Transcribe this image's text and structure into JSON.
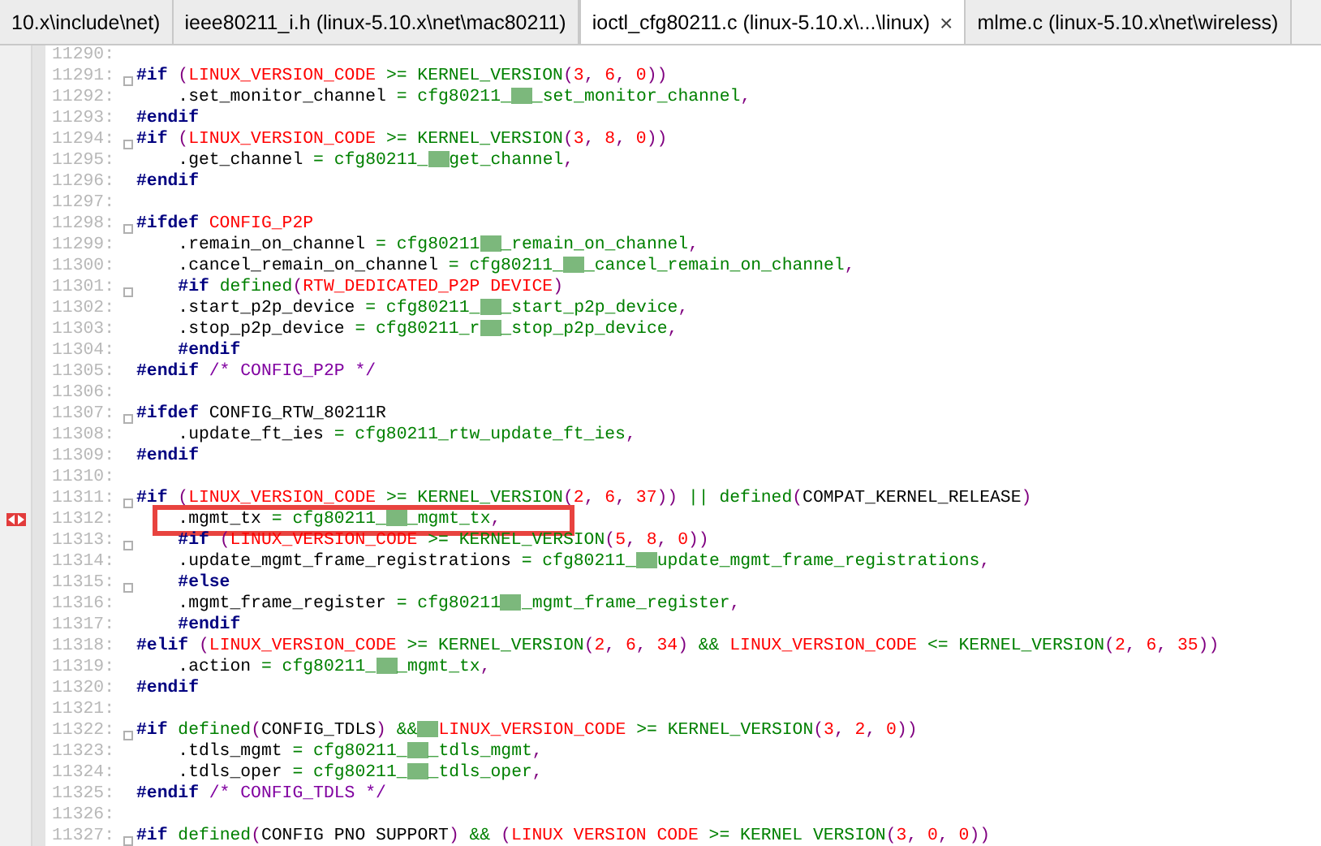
{
  "tabs": [
    {
      "label": "10.x\\include\\net)",
      "selected": false
    },
    {
      "label": "ieee80211_i.h (linux-5.10.x\\net\\mac80211)",
      "selected": false
    },
    {
      "label": "ioctl_cfg80211.c (linux-5.10.x\\...\\linux)",
      "selected": true
    },
    {
      "label": "mlme.c (linux-5.10.x\\net\\wireless)",
      "selected": false
    }
  ],
  "close_glyph": "×",
  "lines": [
    {
      "number": "11290:",
      "fold": false,
      "marker": false,
      "annotated": false
    },
    {
      "number": "11291:",
      "fold": true,
      "marker": false,
      "annotated": false,
      "tokens": [
        {
          "kind": "kw",
          "text": "#if"
        },
        {
          "kind": "p",
          "text": " ("
        },
        {
          "kind": "mac",
          "text": "LINUX_VERSION_CODE"
        },
        {
          "kind": "fn",
          "text": " >= KERNEL_VERSION"
        },
        {
          "kind": "p",
          "text": "("
        },
        {
          "kind": "num",
          "text": "3"
        },
        {
          "kind": "p",
          "text": ", "
        },
        {
          "kind": "num",
          "text": "6"
        },
        {
          "kind": "p",
          "text": ", "
        },
        {
          "kind": "num",
          "text": "0"
        },
        {
          "kind": "p",
          "text": "))"
        }
      ]
    },
    {
      "number": "11292:",
      "fold": false,
      "marker": false,
      "annotated": false,
      "tokens": [
        {
          "kind": "t",
          "text": "    .set_monitor_channel "
        },
        {
          "kind": "fn",
          "text": "= cfg80211_"
        },
        {
          "kind": "blur"
        },
        {
          "kind": "fn",
          "text": "_set_monitor_channel"
        },
        {
          "kind": "p",
          "text": ","
        }
      ]
    },
    {
      "number": "11293:",
      "fold": false,
      "marker": false,
      "annotated": false,
      "tokens": [
        {
          "kind": "kw",
          "text": "#endif"
        }
      ]
    },
    {
      "number": "11294:",
      "fold": true,
      "marker": false,
      "annotated": false,
      "tokens": [
        {
          "kind": "kw",
          "text": "#if"
        },
        {
          "kind": "p",
          "text": " ("
        },
        {
          "kind": "mac",
          "text": "LINUX_VERSION_CODE"
        },
        {
          "kind": "fn",
          "text": " >= KERNEL_VERSION"
        },
        {
          "kind": "p",
          "text": "("
        },
        {
          "kind": "num",
          "text": "3"
        },
        {
          "kind": "p",
          "text": ", "
        },
        {
          "kind": "num",
          "text": "8"
        },
        {
          "kind": "p",
          "text": ", "
        },
        {
          "kind": "num",
          "text": "0"
        },
        {
          "kind": "p",
          "text": "))"
        }
      ]
    },
    {
      "number": "11295:",
      "fold": false,
      "marker": false,
      "annotated": false,
      "tokens": [
        {
          "kind": "t",
          "text": "    .get_channel "
        },
        {
          "kind": "fn",
          "text": "= cfg80211_"
        },
        {
          "kind": "blur"
        },
        {
          "kind": "fn",
          "text": "get_channel"
        },
        {
          "kind": "p",
          "text": ","
        }
      ]
    },
    {
      "number": "11296:",
      "fold": false,
      "marker": false,
      "annotated": false,
      "tokens": [
        {
          "kind": "kw",
          "text": "#endif"
        }
      ]
    },
    {
      "number": "11297:",
      "fold": false,
      "marker": false,
      "annotated": false
    },
    {
      "number": "11298:",
      "fold": true,
      "marker": false,
      "annotated": false,
      "tokens": [
        {
          "kind": "kw",
          "text": "#ifdef"
        },
        {
          "kind": "mac",
          "text": " CONFIG_P2P"
        }
      ]
    },
    {
      "number": "11299:",
      "fold": false,
      "marker": false,
      "annotated": false,
      "tokens": [
        {
          "kind": "t",
          "text": "    .remain_on_channel "
        },
        {
          "kind": "fn",
          "text": "= cfg80211"
        },
        {
          "kind": "blur"
        },
        {
          "kind": "fn",
          "text": "_remain_on_channel"
        },
        {
          "kind": "p",
          "text": ","
        }
      ]
    },
    {
      "number": "11300:",
      "fold": false,
      "marker": false,
      "annotated": false,
      "tokens": [
        {
          "kind": "t",
          "text": "    .cancel_remain_on_channel "
        },
        {
          "kind": "fn",
          "text": "= cfg80211_"
        },
        {
          "kind": "blur"
        },
        {
          "kind": "fn",
          "text": "_cancel_remain_on_channel"
        },
        {
          "kind": "p",
          "text": ","
        }
      ]
    },
    {
      "number": "11301:",
      "fold": true,
      "marker": false,
      "annotated": false,
      "tokens": [
        {
          "kind": "kw",
          "text": "    #if"
        },
        {
          "kind": "fn",
          "text": " defined"
        },
        {
          "kind": "p",
          "text": "("
        },
        {
          "kind": "mac",
          "text": "RTW_DEDICATED_P2P DEVICE"
        },
        {
          "kind": "p",
          "text": ")"
        }
      ]
    },
    {
      "number": "11302:",
      "fold": false,
      "marker": false,
      "annotated": false,
      "tokens": [
        {
          "kind": "t",
          "text": "    .start_p2p_device "
        },
        {
          "kind": "fn",
          "text": "= cfg80211_"
        },
        {
          "kind": "blur"
        },
        {
          "kind": "fn",
          "text": "_start_p2p_device"
        },
        {
          "kind": "p",
          "text": ","
        }
      ]
    },
    {
      "number": "11303:",
      "fold": false,
      "marker": false,
      "annotated": false,
      "tokens": [
        {
          "kind": "t",
          "text": "    .stop_p2p_device "
        },
        {
          "kind": "fn",
          "text": "= cfg80211_r"
        },
        {
          "kind": "blur"
        },
        {
          "kind": "fn",
          "text": "_stop_p2p_device"
        },
        {
          "kind": "p",
          "text": ","
        }
      ]
    },
    {
      "number": "11304:",
      "fold": false,
      "marker": false,
      "annotated": false,
      "tokens": [
        {
          "kind": "kw",
          "text": "    #endif"
        }
      ]
    },
    {
      "number": "11305:",
      "fold": false,
      "marker": false,
      "annotated": false,
      "tokens": [
        {
          "kind": "kw",
          "text": "#endif"
        },
        {
          "kind": "cm",
          "text": " /* CONFIG_P2P */"
        }
      ]
    },
    {
      "number": "11306:",
      "fold": false,
      "marker": false,
      "annotated": false
    },
    {
      "number": "11307:",
      "fold": true,
      "marker": false,
      "annotated": false,
      "tokens": [
        {
          "kind": "kw",
          "text": "#ifdef"
        },
        {
          "kind": "t",
          "text": " CONFIG_RTW_80211R"
        }
      ]
    },
    {
      "number": "11308:",
      "fold": false,
      "marker": false,
      "annotated": false,
      "tokens": [
        {
          "kind": "t",
          "text": "    .update_ft_ies "
        },
        {
          "kind": "fn",
          "text": "= cfg80211_rtw_update_ft_ies"
        },
        {
          "kind": "p",
          "text": ","
        }
      ]
    },
    {
      "number": "11309:",
      "fold": false,
      "marker": false,
      "annotated": false,
      "tokens": [
        {
          "kind": "kw",
          "text": "#endif"
        }
      ]
    },
    {
      "number": "11310:",
      "fold": false,
      "marker": false,
      "annotated": false
    },
    {
      "number": "11311:",
      "fold": true,
      "marker": false,
      "annotated": false,
      "tokens": [
        {
          "kind": "kw",
          "text": "#if"
        },
        {
          "kind": "p",
          "text": " ("
        },
        {
          "kind": "mac",
          "text": "LINUX_VERSION_CODE"
        },
        {
          "kind": "fn",
          "text": " >= KERNEL_VERSION"
        },
        {
          "kind": "p",
          "text": "("
        },
        {
          "kind": "num",
          "text": "2"
        },
        {
          "kind": "p",
          "text": ", "
        },
        {
          "kind": "num",
          "text": "6"
        },
        {
          "kind": "p",
          "text": ", "
        },
        {
          "kind": "num",
          "text": "37"
        },
        {
          "kind": "p",
          "text": "))"
        },
        {
          "kind": "fn",
          "text": " || defined"
        },
        {
          "kind": "p",
          "text": "("
        },
        {
          "kind": "t",
          "text": "COMPAT_KERNEL_RELEASE"
        },
        {
          "kind": "p",
          "text": ")"
        }
      ]
    },
    {
      "number": "11312:",
      "fold": false,
      "marker": true,
      "annotated": true,
      "tokens": [
        {
          "kind": "t",
          "text": "    .mgmt_tx "
        },
        {
          "kind": "fn",
          "text": "= cfg80211_"
        },
        {
          "kind": "blur"
        },
        {
          "kind": "fn",
          "text": "_mgmt_tx"
        },
        {
          "kind": "p",
          "text": ","
        }
      ]
    },
    {
      "number": "11313:",
      "fold": true,
      "marker": false,
      "annotated": false,
      "tokens": [
        {
          "kind": "kw",
          "text": "    #if"
        },
        {
          "kind": "p",
          "text": " ("
        },
        {
          "kind": "mac",
          "text": "LINUX_VERSION_CODE"
        },
        {
          "kind": "fn",
          "text": " >= KERNEL_VERSION"
        },
        {
          "kind": "p",
          "text": "("
        },
        {
          "kind": "num",
          "text": "5"
        },
        {
          "kind": "p",
          "text": ", "
        },
        {
          "kind": "num",
          "text": "8"
        },
        {
          "kind": "p",
          "text": ", "
        },
        {
          "kind": "num",
          "text": "0"
        },
        {
          "kind": "p",
          "text": "))"
        }
      ]
    },
    {
      "number": "11314:",
      "fold": false,
      "marker": false,
      "annotated": false,
      "tokens": [
        {
          "kind": "t",
          "text": "    .update_mgmt_frame_registrations "
        },
        {
          "kind": "fn",
          "text": "= cfg80211_"
        },
        {
          "kind": "blur"
        },
        {
          "kind": "fn",
          "text": "update_mgmt_frame_registrations"
        },
        {
          "kind": "p",
          "text": ","
        }
      ]
    },
    {
      "number": "11315:",
      "fold": true,
      "marker": false,
      "annotated": false,
      "tokens": [
        {
          "kind": "kw",
          "text": "    #else"
        }
      ]
    },
    {
      "number": "11316:",
      "fold": false,
      "marker": false,
      "annotated": false,
      "tokens": [
        {
          "kind": "t",
          "text": "    .mgmt_frame_register "
        },
        {
          "kind": "fn",
          "text": "= cfg80211"
        },
        {
          "kind": "blur"
        },
        {
          "kind": "fn",
          "text": "_mgmt_frame_register"
        },
        {
          "kind": "p",
          "text": ","
        }
      ]
    },
    {
      "number": "11317:",
      "fold": false,
      "marker": false,
      "annotated": false,
      "tokens": [
        {
          "kind": "kw",
          "text": "    #endif"
        }
      ]
    },
    {
      "number": "11318:",
      "fold": false,
      "marker": false,
      "annotated": false,
      "tokens": [
        {
          "kind": "kw",
          "text": "#elif"
        },
        {
          "kind": "p",
          "text": " ("
        },
        {
          "kind": "mac",
          "text": "LINUX_VERSION_CODE"
        },
        {
          "kind": "fn",
          "text": " >= KERNEL_VERSION"
        },
        {
          "kind": "p",
          "text": "("
        },
        {
          "kind": "num",
          "text": "2"
        },
        {
          "kind": "p",
          "text": ", "
        },
        {
          "kind": "num",
          "text": "6"
        },
        {
          "kind": "p",
          "text": ", "
        },
        {
          "kind": "num",
          "text": "34"
        },
        {
          "kind": "p",
          "text": ")"
        },
        {
          "kind": "fn",
          "text": " && "
        },
        {
          "kind": "mac",
          "text": "LINUX_VERSION_CODE"
        },
        {
          "kind": "fn",
          "text": " <= KERNEL_VERSION"
        },
        {
          "kind": "p",
          "text": "("
        },
        {
          "kind": "num",
          "text": "2"
        },
        {
          "kind": "p",
          "text": ", "
        },
        {
          "kind": "num",
          "text": "6"
        },
        {
          "kind": "p",
          "text": ", "
        },
        {
          "kind": "num",
          "text": "35"
        },
        {
          "kind": "p",
          "text": "))"
        }
      ]
    },
    {
      "number": "11319:",
      "fold": false,
      "marker": false,
      "annotated": false,
      "tokens": [
        {
          "kind": "t",
          "text": "    .action "
        },
        {
          "kind": "fn",
          "text": "= cfg80211_"
        },
        {
          "kind": "blur"
        },
        {
          "kind": "fn",
          "text": "_mgmt_tx"
        },
        {
          "kind": "p",
          "text": ","
        }
      ]
    },
    {
      "number": "11320:",
      "fold": false,
      "marker": false,
      "annotated": false,
      "tokens": [
        {
          "kind": "kw",
          "text": "#endif"
        }
      ]
    },
    {
      "number": "11321:",
      "fold": false,
      "marker": false,
      "annotated": false
    },
    {
      "number": "11322:",
      "fold": true,
      "marker": false,
      "annotated": false,
      "tokens": [
        {
          "kind": "kw",
          "text": "#if"
        },
        {
          "kind": "fn",
          "text": " defined"
        },
        {
          "kind": "p",
          "text": "("
        },
        {
          "kind": "t",
          "text": "CONFIG_TDLS"
        },
        {
          "kind": "p",
          "text": ")"
        },
        {
          "kind": "fn",
          "text": " &&"
        },
        {
          "kind": "blur"
        },
        {
          "kind": "mac",
          "text": "LINUX_VERSION_CODE"
        },
        {
          "kind": "fn",
          "text": " >= KERNEL_VERSION"
        },
        {
          "kind": "p",
          "text": "("
        },
        {
          "kind": "num",
          "text": "3"
        },
        {
          "kind": "p",
          "text": ", "
        },
        {
          "kind": "num",
          "text": "2"
        },
        {
          "kind": "p",
          "text": ", "
        },
        {
          "kind": "num",
          "text": "0"
        },
        {
          "kind": "p",
          "text": "))"
        }
      ]
    },
    {
      "number": "11323:",
      "fold": false,
      "marker": false,
      "annotated": false,
      "tokens": [
        {
          "kind": "t",
          "text": "    .tdls_mgmt "
        },
        {
          "kind": "fn",
          "text": "= cfg80211_"
        },
        {
          "kind": "blur"
        },
        {
          "kind": "fn",
          "text": "_tdls_mgmt"
        },
        {
          "kind": "p",
          "text": ","
        }
      ]
    },
    {
      "number": "11324:",
      "fold": false,
      "marker": false,
      "annotated": false,
      "tokens": [
        {
          "kind": "t",
          "text": "    .tdls_oper "
        },
        {
          "kind": "fn",
          "text": "= cfg80211_"
        },
        {
          "kind": "blur"
        },
        {
          "kind": "fn",
          "text": "_tdls_oper"
        },
        {
          "kind": "p",
          "text": ","
        }
      ]
    },
    {
      "number": "11325:",
      "fold": false,
      "marker": false,
      "annotated": false,
      "tokens": [
        {
          "kind": "kw",
          "text": "#endif"
        },
        {
          "kind": "cm",
          "text": " /* CONFIG_TDLS */"
        }
      ]
    },
    {
      "number": "11326:",
      "fold": false,
      "marker": false,
      "annotated": false
    },
    {
      "number": "11327:",
      "fold": true,
      "marker": false,
      "annotated": false,
      "tokens": [
        {
          "kind": "kw",
          "text": "#if"
        },
        {
          "kind": "fn",
          "text": " defined"
        },
        {
          "kind": "p",
          "text": "("
        },
        {
          "kind": "t",
          "text": "CONFIG PNO SUPPORT"
        },
        {
          "kind": "p",
          "text": ")"
        },
        {
          "kind": "fn",
          "text": " && "
        },
        {
          "kind": "p",
          "text": "("
        },
        {
          "kind": "mac",
          "text": "LINUX VERSION CODE"
        },
        {
          "kind": "fn",
          "text": " >= KERNEL VERSION"
        },
        {
          "kind": "p",
          "text": "("
        },
        {
          "kind": "num",
          "text": "3"
        },
        {
          "kind": "p",
          "text": ", "
        },
        {
          "kind": "num",
          "text": "0"
        },
        {
          "kind": "p",
          "text": ", "
        },
        {
          "kind": "num",
          "text": "0"
        },
        {
          "kind": "p",
          "text": "))"
        }
      ]
    }
  ]
}
